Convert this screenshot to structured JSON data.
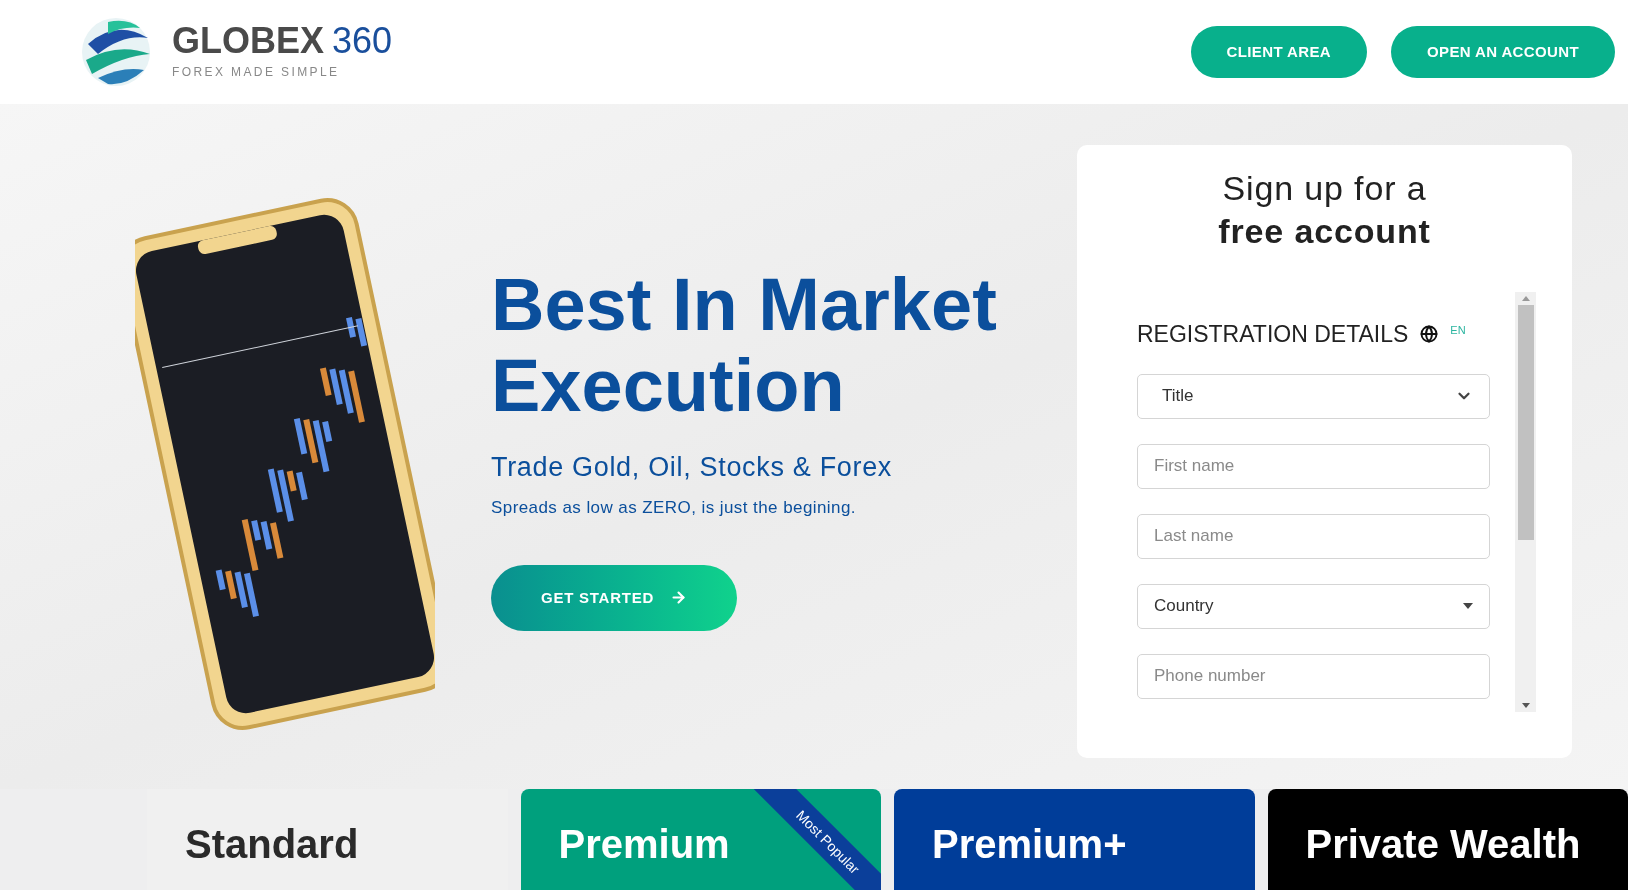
{
  "header": {
    "logo": {
      "name": "GLOBEX",
      "number": "360",
      "tagline": "FOREX MADE SIMPLE"
    },
    "buttons": [
      "CLIENT AREA",
      "OPEN AN ACCOUNT"
    ]
  },
  "hero": {
    "heading": "Best In Market Execution",
    "subheading": "Trade Gold, Oil, Stocks & Forex",
    "tagline": "Spreads as low as ZERO, is just the begining.",
    "cta": "GET STARTED"
  },
  "signup": {
    "title": "Sign up for a **free account**",
    "section": "REGISTRATION DETAILS",
    "language": "EN",
    "fields": [
      {
        "kind": "select",
        "value": "Title"
      },
      {
        "kind": "input",
        "placeholder": "First name"
      },
      {
        "kind": "input",
        "placeholder": "Last name"
      },
      {
        "kind": "combo",
        "value": "Country"
      },
      {
        "kind": "input",
        "placeholder": "Phone number"
      }
    ]
  },
  "plans": [
    {
      "name": "Standard",
      "color": "#f0f0f0"
    },
    {
      "name": "Premium",
      "color": "#00a07d",
      "ribbon": "Most Popular"
    },
    {
      "name": "Premium+",
      "color": "#003d99"
    },
    {
      "name": "Private Wealth",
      "color": "#000000"
    }
  ]
}
